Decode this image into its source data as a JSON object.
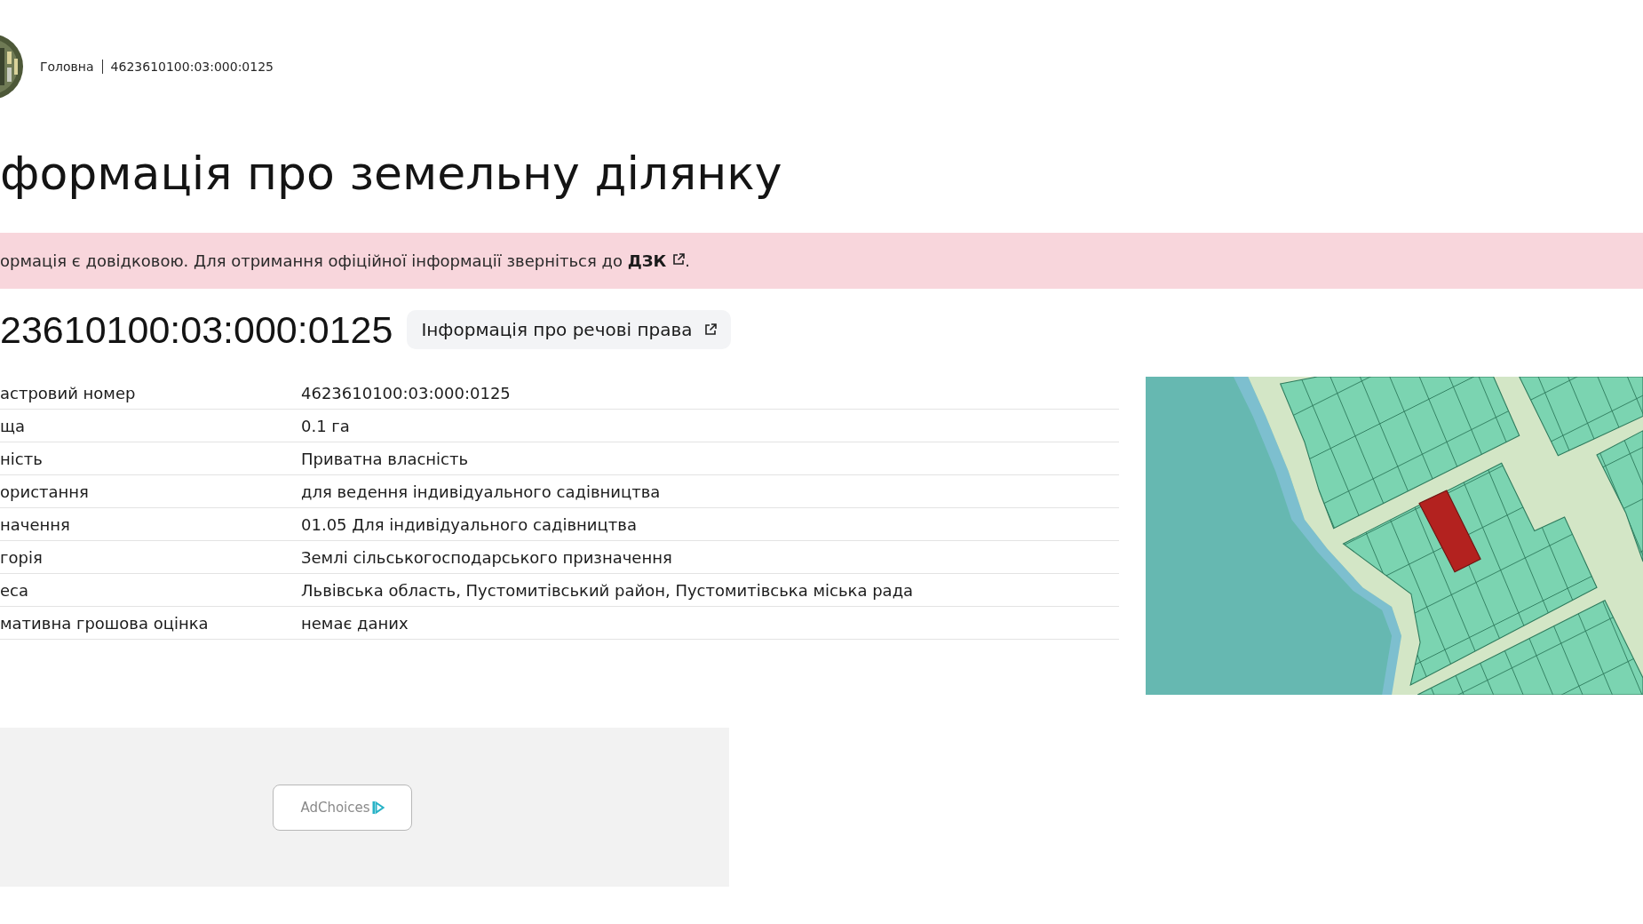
{
  "breadcrumbs": [
    {
      "label": "Головна"
    },
    {
      "label": "4623610100:03:000:0125"
    }
  ],
  "title": "формація про земельну ділянку",
  "notice": {
    "text": "ормація є довідковою. Для отримання офіційної інформації зверніться до",
    "link": "ДЗК",
    "after": "."
  },
  "parcel": {
    "number": "23610100:03:000:0125",
    "rights_button": "Інформація про речові права"
  },
  "details": [
    {
      "label": "астровий номер",
      "value": "4623610100:03:000:0125"
    },
    {
      "label": "ща",
      "value": "0.1 га"
    },
    {
      "label": "ність",
      "value": "Приватна власність"
    },
    {
      "label": "ористання",
      "value": "для ведення індивідуального садівництва"
    },
    {
      "label": "начення",
      "value": "01.05 Для індивідуального садівництва"
    },
    {
      "label": "горія",
      "value": "Землі сільськогосподарського призначення"
    },
    {
      "label": "еса",
      "value": "Львівська область, Пустомитівський район, Пустомитівська міська рада"
    },
    {
      "label": "мативна грошова оцінка",
      "value": "немає даних"
    }
  ],
  "ad": {
    "button": "AdChoices"
  }
}
